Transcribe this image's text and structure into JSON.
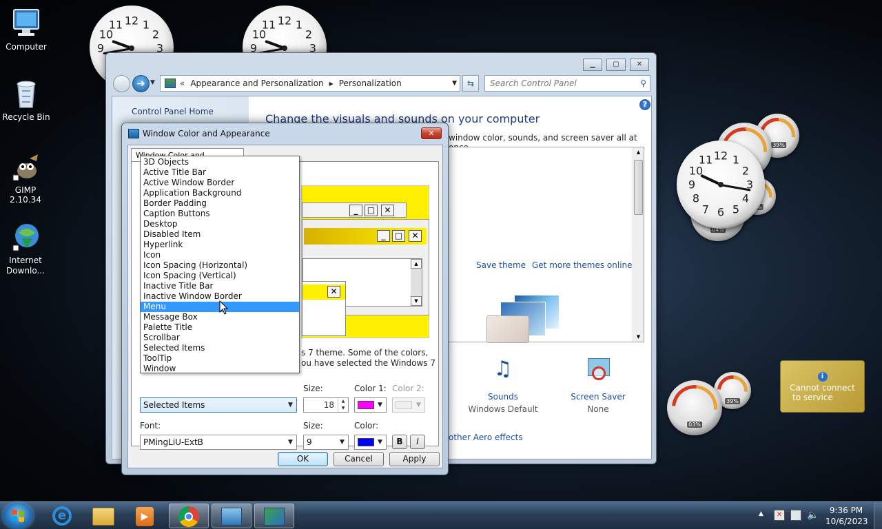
{
  "desktop": {
    "icons": [
      {
        "label": "Computer"
      },
      {
        "label": "Recycle Bin"
      },
      {
        "label": "GIMP 2.10.34"
      },
      {
        "label": "Internet Downlo..."
      }
    ]
  },
  "control_panel": {
    "breadcrumb_prefix": "«",
    "breadcrumb": [
      "Appearance and Personalization",
      "Personalization"
    ],
    "search_placeholder": "Search Control Panel",
    "sidebar_home": "Control Panel Home",
    "heading": "Change the visuals and sounds on your computer",
    "subtext": "window color, sounds, and screen saver all at once.",
    "save_theme": "Save theme",
    "get_more_themes": "Get more themes online",
    "sounds_label": "Sounds",
    "sounds_value": "Windows Default",
    "screensaver_label": "Screen Saver",
    "screensaver_value": "None",
    "aero_link": "other Aero effects"
  },
  "dialog": {
    "title": "Window Color and Appearance",
    "close_glyph": "✕",
    "tab_label": "Window Color and Appearance",
    "theme_text_line1": "s 7 theme.  Some of the colors,",
    "theme_text_line2": "ou have selected the Windows 7",
    "item_combo_value": "Selected Items",
    "size_label": "Size:",
    "size_value": "18",
    "color1_label": "Color 1:",
    "color2_label": "Color 2:",
    "font_label": "Font:",
    "font_value": "PMingLiU-ExtB",
    "font_size_label": "Size:",
    "font_size_value": "9",
    "font_color_label": "Color:",
    "bold_label": "B",
    "italic_label": "I",
    "ok_label": "OK",
    "cancel_label": "Cancel",
    "apply_label": "Apply",
    "color1_hex": "#ff00ff",
    "font_color_hex": "#0000ff",
    "dropdown_items": [
      "3D Objects",
      "Active Title Bar",
      "Active Window Border",
      "Application Background",
      "Border Padding",
      "Caption Buttons",
      "Desktop",
      "Disabled Item",
      "Hyperlink",
      "Icon",
      "Icon Spacing (Horizontal)",
      "Icon Spacing (Vertical)",
      "Inactive Title Bar",
      "Inactive Window Border",
      "Menu",
      "Message Box",
      "Palette Title",
      "Scrollbar",
      "Selected Items",
      "ToolTip",
      "Window"
    ],
    "dropdown_selected": "Menu"
  },
  "gadgets": {
    "meter_labels": [
      "39%",
      "04%",
      "9%",
      "03%",
      "39%"
    ],
    "weather_text_line1": "Cannot connect",
    "weather_text_line2": "to service",
    "clock_numbers": [
      "12",
      "1",
      "2",
      "3",
      "4",
      "5",
      "6",
      "7",
      "8",
      "9",
      "10",
      "11"
    ]
  },
  "taskbar": {
    "time": "9:36 PM",
    "date": "10/6/2023"
  }
}
